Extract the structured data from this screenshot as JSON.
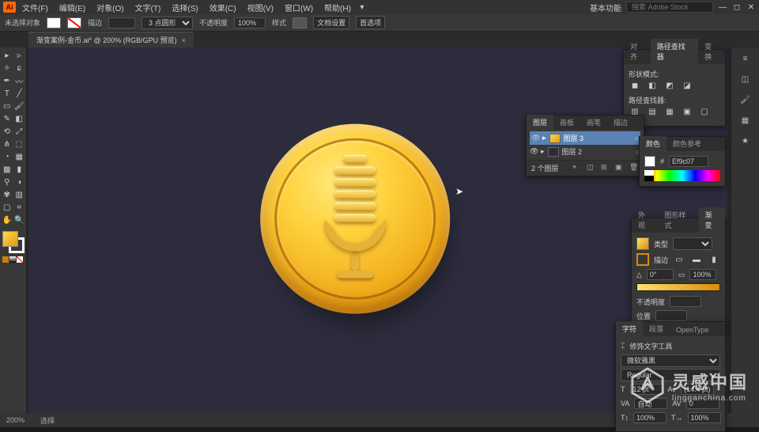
{
  "menubar": {
    "app": "Ai",
    "items": [
      "文件(F)",
      "编辑(E)",
      "对象(O)",
      "文字(T)",
      "选择(S)",
      "效果(C)",
      "视图(V)",
      "窗口(W)",
      "帮助(H)"
    ],
    "right_label": "基本功能",
    "search_placeholder": "搜索 Adobe Stock"
  },
  "optbar": {
    "noselect": "未选择对象",
    "stroke_label": "描边",
    "stroke_val": "",
    "brush_val": "3 点圆形",
    "opacity_label": "不透明度",
    "opacity_val": "100%",
    "style_label": "样式",
    "docset": "文档设置",
    "prefs": "首选项"
  },
  "tab": {
    "title": "渐变案例-金币.ai* @ 200% (RGB/GPU 预览)"
  },
  "panels": {
    "align": {
      "tabs": [
        "对齐",
        "路径查找器",
        "变换"
      ],
      "sect1": "形状模式:",
      "sect2": "路径查找器:"
    },
    "layers": {
      "tabs": [
        "图层",
        "画板",
        "画笔",
        "描边"
      ],
      "rows": [
        {
          "name": "图层 3",
          "selected": true
        },
        {
          "name": "图层 2",
          "selected": false
        }
      ],
      "footer_count": "2 个图层"
    },
    "color": {
      "tabs": [
        "颜色",
        "颜色参考"
      ],
      "hex_label": "#",
      "hex_val": "Ef9c07"
    },
    "gradient": {
      "tabs": [
        "外观",
        "图形样式",
        "渐变"
      ],
      "type_label": "类型",
      "type_val": "",
      "stroke_label": "描边",
      "angle_val": "0°",
      "ratio_val": "100%",
      "opacity_label": "不透明度",
      "opacity_val": "",
      "pos_label": "位置",
      "pos_val": ""
    },
    "char": {
      "tabs": [
        "字符",
        "段落",
        "OpenType"
      ],
      "touch_tool": "修饰文字工具",
      "font": "微软雅黑",
      "weight": "Regular",
      "size": "12 pt",
      "leading": "(14.4 pt)",
      "tracking": "0",
      "kerning": "自动",
      "hscale": "100%",
      "vscale": "100%"
    }
  },
  "status": {
    "zoom": "200%",
    "tool": "选择"
  },
  "watermark": {
    "cn": "灵感中国",
    "en": "lingganchina.com"
  }
}
